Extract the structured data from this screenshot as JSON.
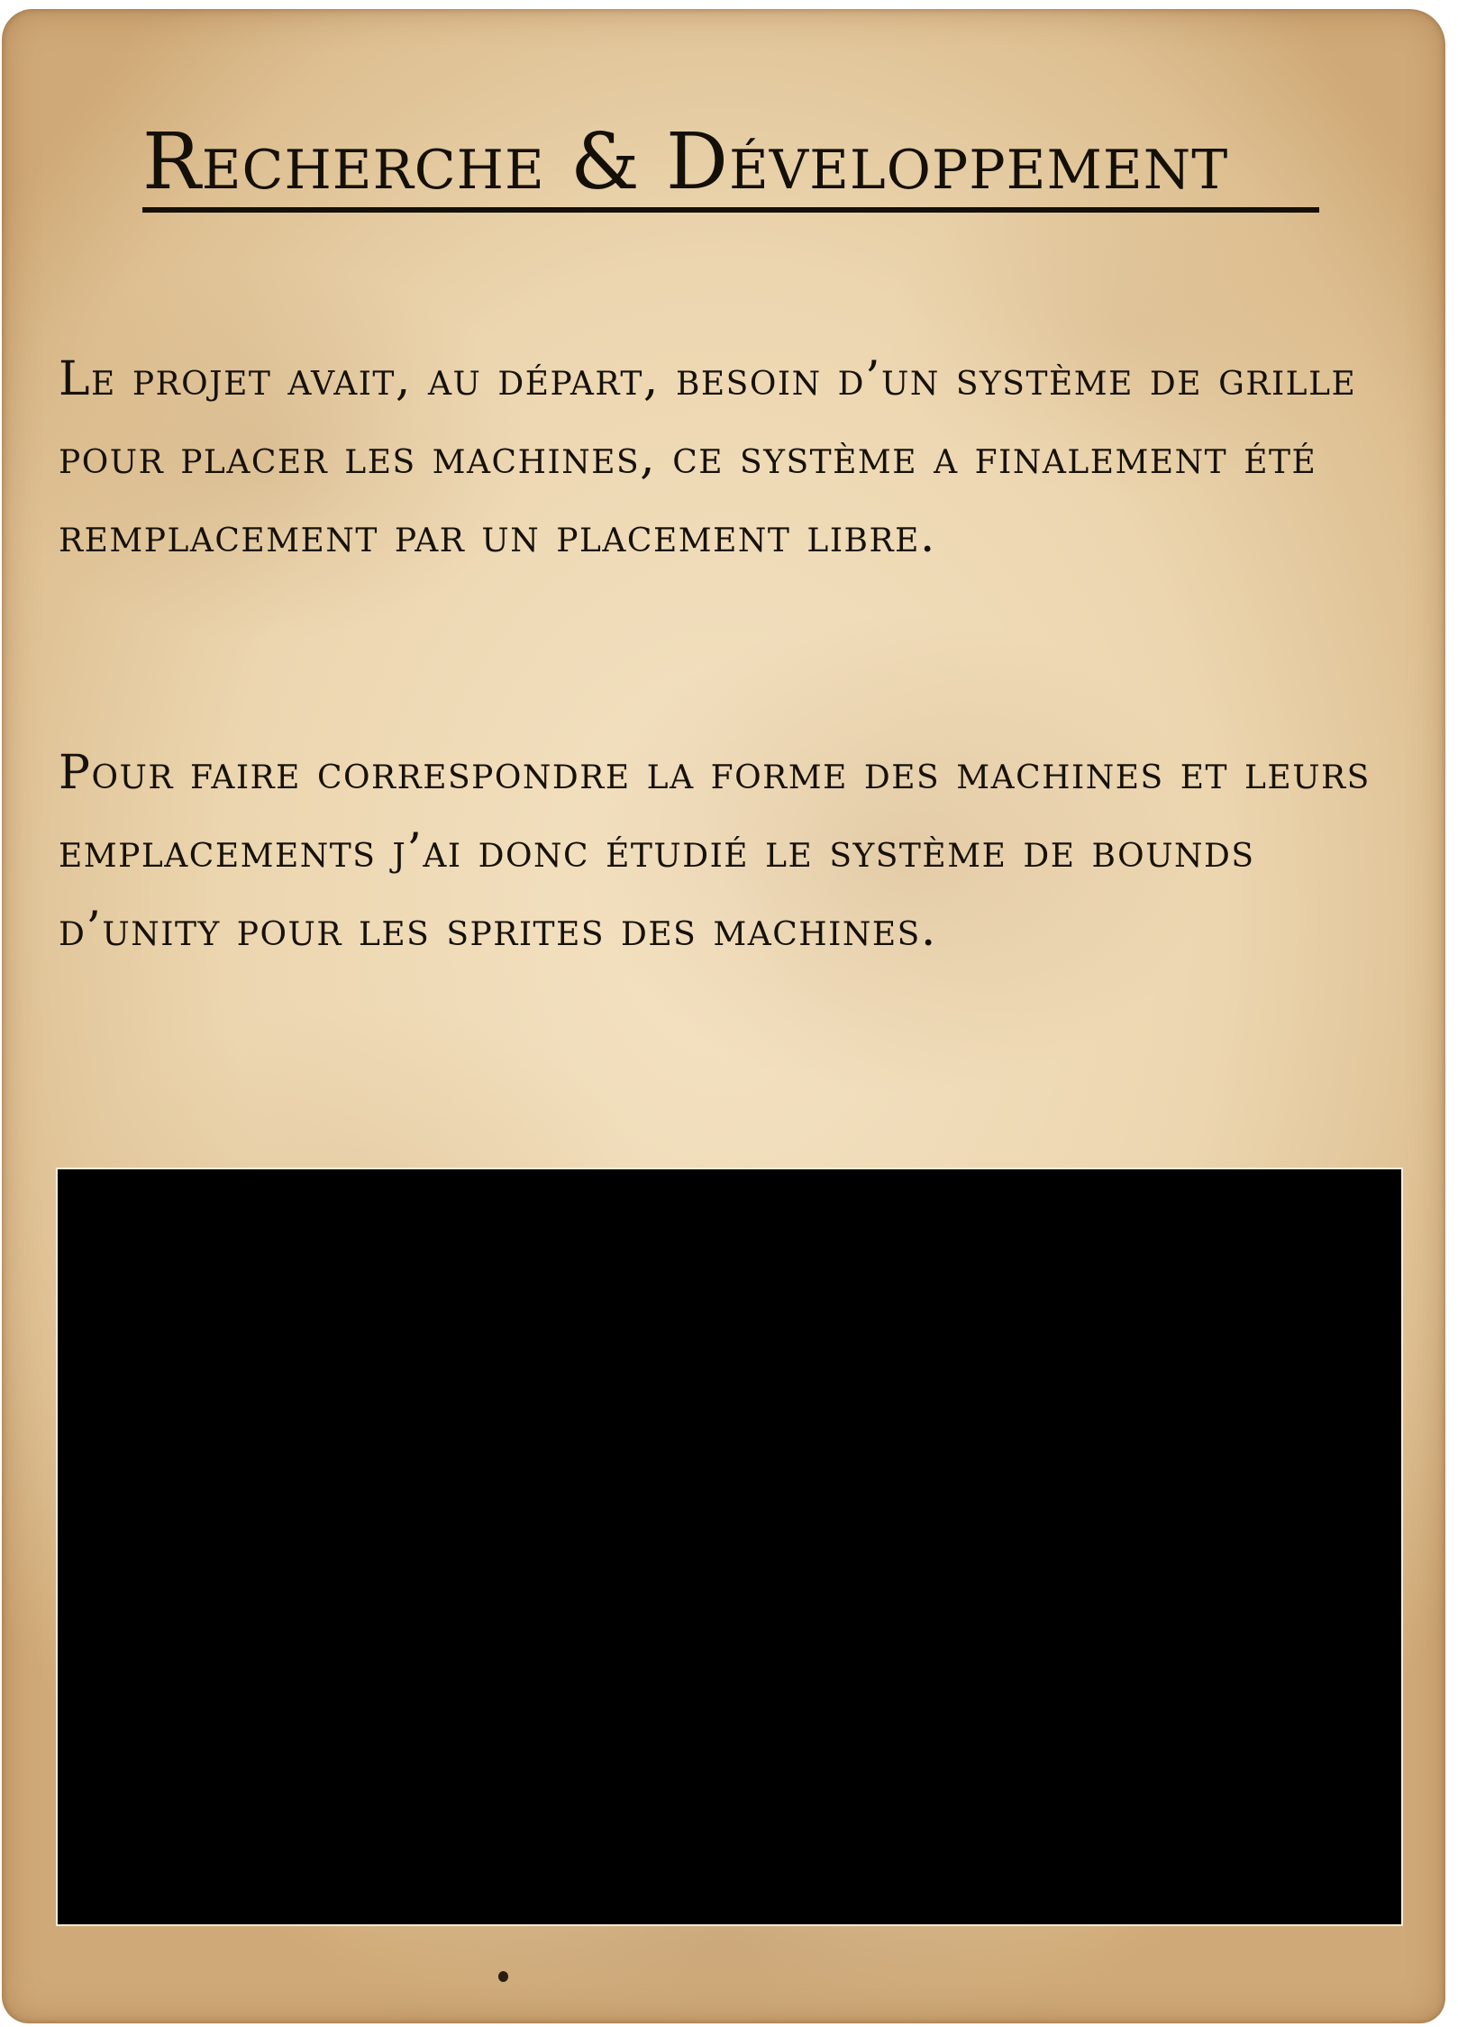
{
  "page": {
    "title": "Recherche & Développement",
    "paragraphs": [
      "Le projet avait, au départ, besoin d’un système de grille pour placer les machines, ce système a finalement été remplacement par un placement libre.",
      "Pour faire correspondre la forme des machines et leurs emplacements j’ai donc étudié le système de bounds d’unity pour les sprites des machines."
    ],
    "media": {
      "fill_color": "#000000"
    }
  },
  "colors": {
    "parchment": "#ecd6b0",
    "ink": "#141008"
  }
}
